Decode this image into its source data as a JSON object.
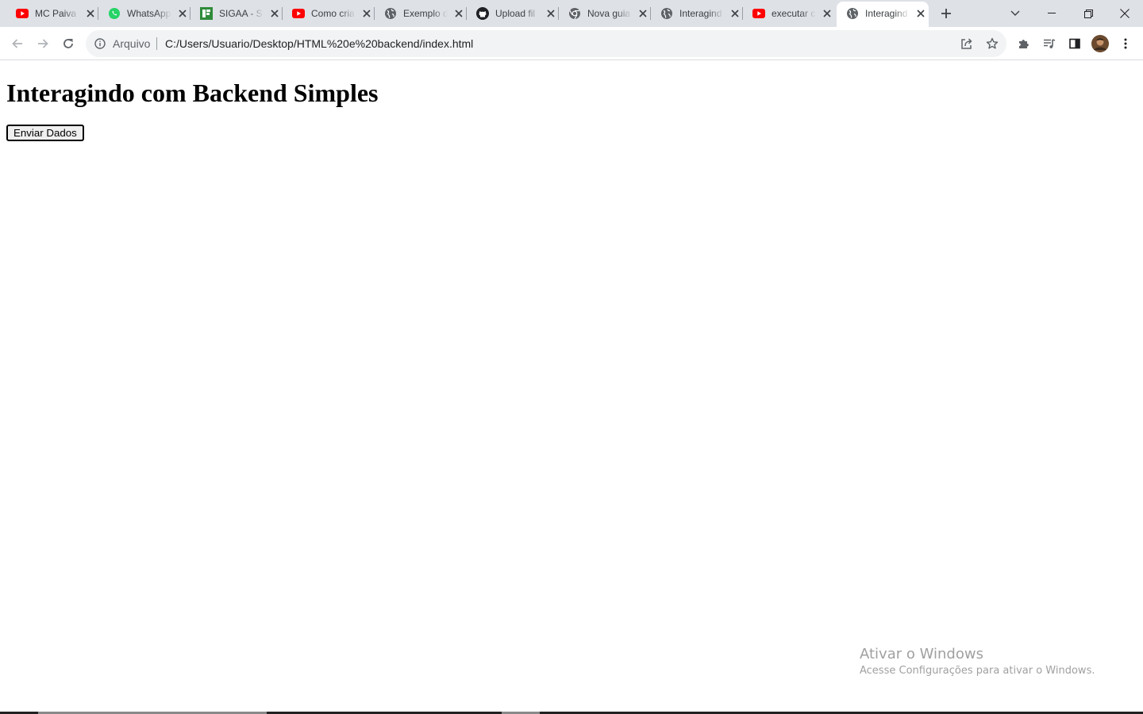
{
  "browser": {
    "tabs": [
      {
        "title": "MC Paiva",
        "icon": "youtube-icon",
        "active": false
      },
      {
        "title": "WhatsApp",
        "icon": "whatsapp-icon",
        "active": false
      },
      {
        "title": "SIGAA - S",
        "icon": "sigaa-icon",
        "active": false
      },
      {
        "title": "Como cria",
        "icon": "youtube-icon",
        "active": false
      },
      {
        "title": "Exemplo d",
        "icon": "globe-icon",
        "active": false
      },
      {
        "title": "Upload fil",
        "icon": "github-icon",
        "active": false
      },
      {
        "title": "Nova guia",
        "icon": "chrome-icon",
        "active": false
      },
      {
        "title": "Interagind",
        "icon": "globe-icon",
        "active": false
      },
      {
        "title": "executar c",
        "icon": "youtube-icon",
        "active": false
      },
      {
        "title": "Interagind",
        "icon": "globe-icon",
        "active": true
      }
    ],
    "address_bar": {
      "security_chip": "Arquivo",
      "url": "C:/Users/Usuario/Desktop/HTML%20e%20backend/index.html"
    },
    "colors": {
      "tabstrip_bg": "#dee1e6",
      "omnibox_bg": "#f1f3f4",
      "youtube_red": "#ff0000",
      "whatsapp_green": "#25d366",
      "sigaa_green": "#2e8b3a"
    }
  },
  "page": {
    "heading": "Interagindo com Backend Simples",
    "button_label": "Enviar Dados"
  },
  "watermark": {
    "title": "Ativar o Windows",
    "subtitle": "Acesse Configurações para ativar o Windows."
  }
}
